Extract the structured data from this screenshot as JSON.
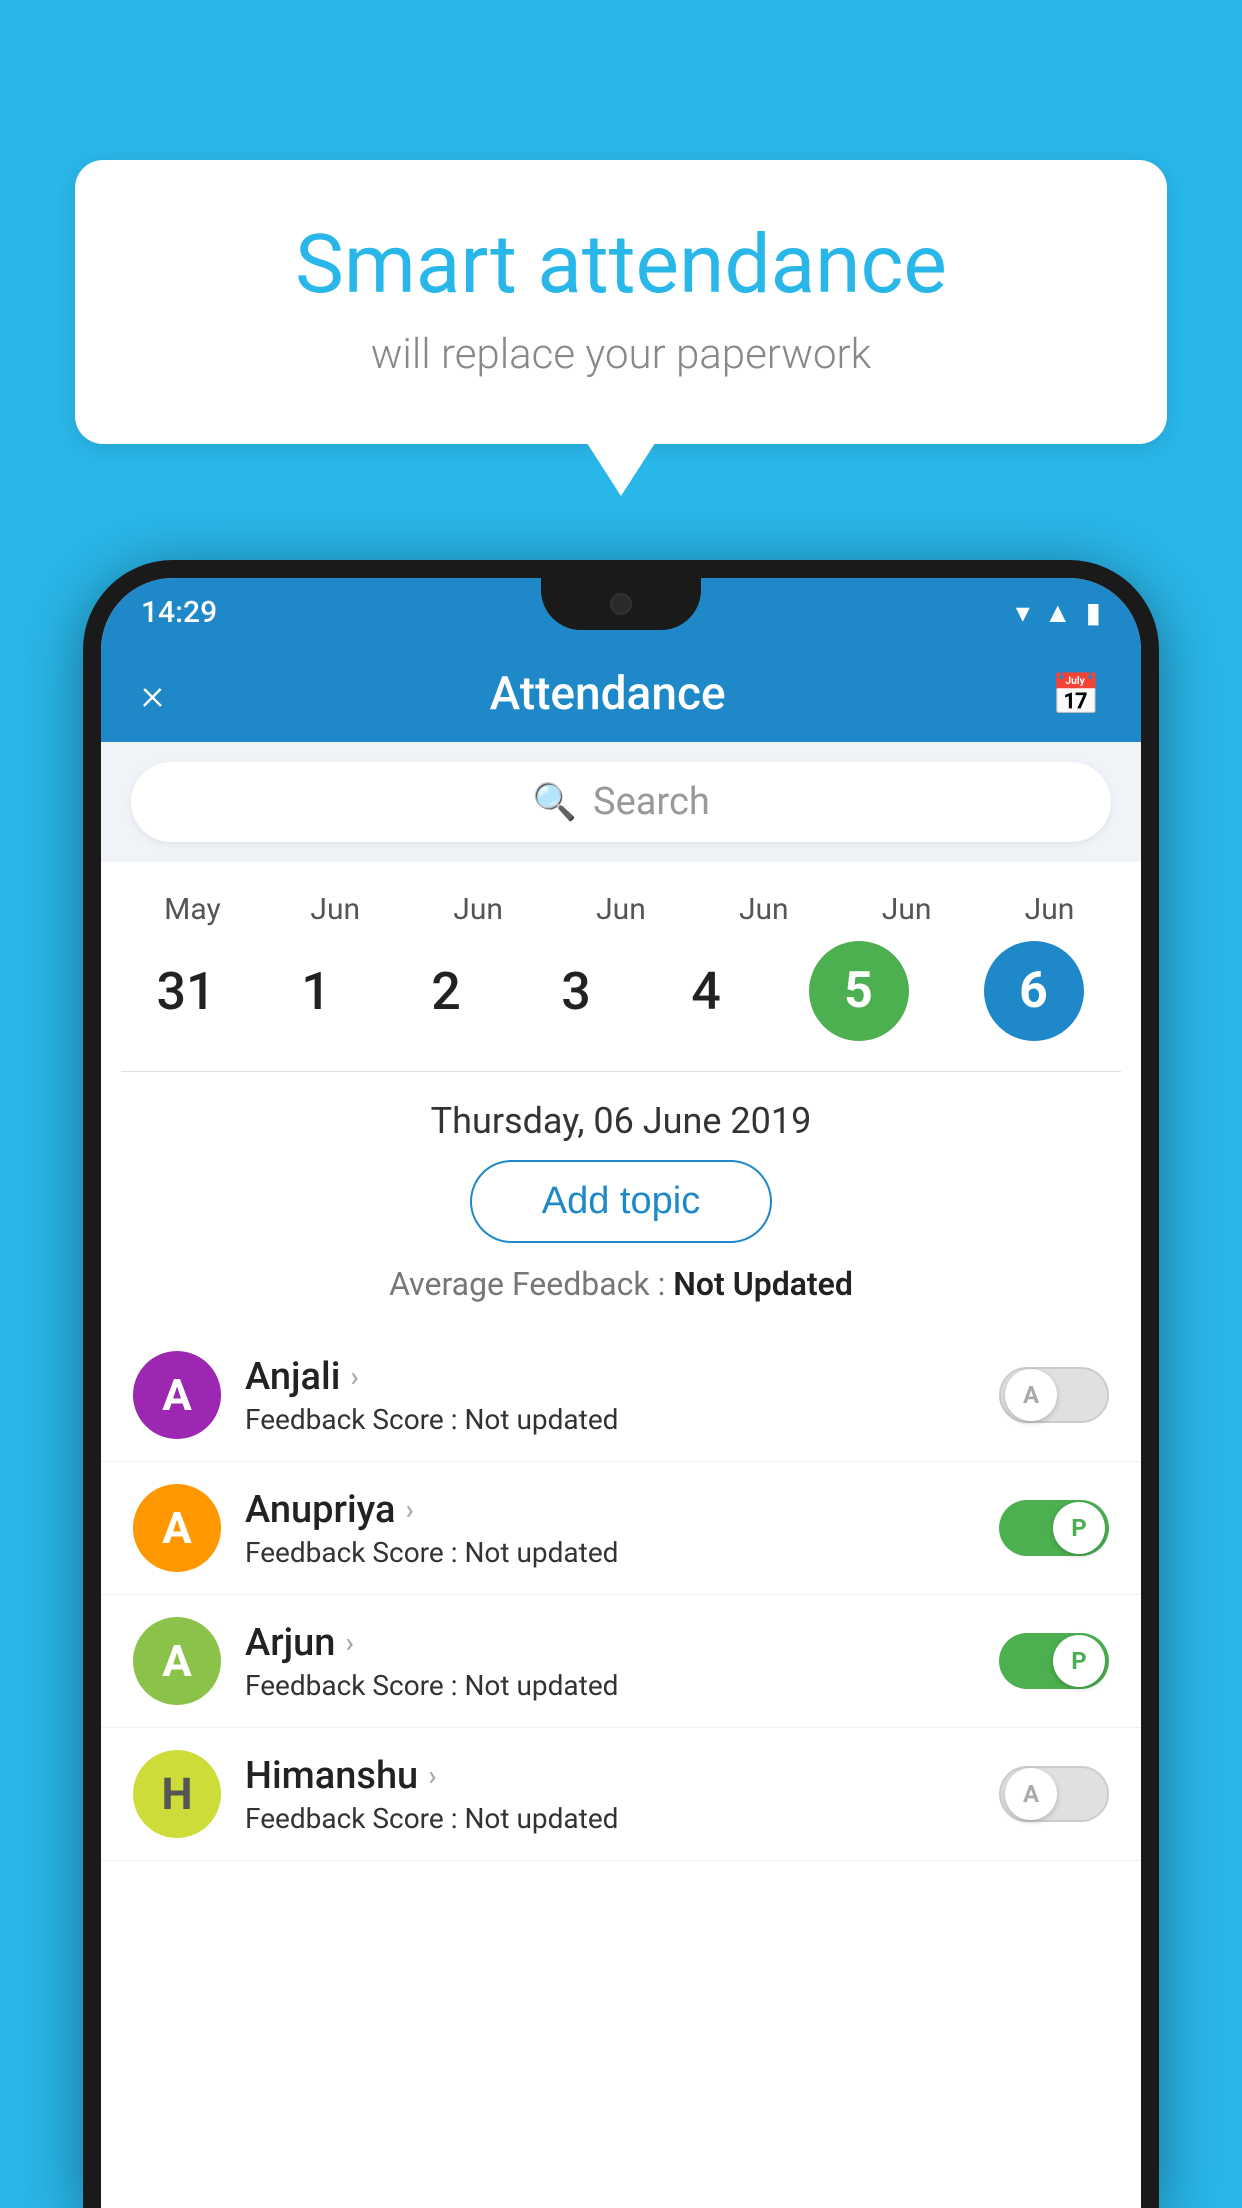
{
  "background_color": "#29b6e8",
  "bubble": {
    "title": "Smart attendance",
    "subtitle": "will replace your paperwork"
  },
  "status_bar": {
    "time": "14:29",
    "icons": [
      "▲",
      "▲",
      "▮"
    ]
  },
  "header": {
    "title": "Attendance",
    "close_label": "×",
    "calendar_icon": "📅"
  },
  "search": {
    "placeholder": "Search"
  },
  "calendar": {
    "months": [
      "May",
      "Jun",
      "Jun",
      "Jun",
      "Jun",
      "Jun",
      "Jun"
    ],
    "dates": [
      "31",
      "1",
      "2",
      "3",
      "4",
      "5",
      "6"
    ],
    "today_index": 5,
    "selected_index": 6
  },
  "selected_date": "Thursday, 06 June 2019",
  "add_topic_label": "Add topic",
  "feedback_summary": {
    "label": "Average Feedback :",
    "value": "Not Updated"
  },
  "students": [
    {
      "name": "Anjali",
      "avatar_letter": "A",
      "avatar_color": "purple",
      "feedback_label": "Feedback Score :",
      "feedback_value": "Not updated",
      "toggle": "off",
      "toggle_label": "A"
    },
    {
      "name": "Anupriya",
      "avatar_letter": "A",
      "avatar_color": "orange",
      "feedback_label": "Feedback Score :",
      "feedback_value": "Not updated",
      "toggle": "on",
      "toggle_label": "P"
    },
    {
      "name": "Arjun",
      "avatar_letter": "A",
      "avatar_color": "green",
      "feedback_label": "Feedback Score :",
      "feedback_value": "Not updated",
      "toggle": "on",
      "toggle_label": "P"
    },
    {
      "name": "Himanshu",
      "avatar_letter": "H",
      "avatar_color": "lime",
      "feedback_label": "Feedback Score :",
      "feedback_value": "Not updated",
      "toggle": "off",
      "toggle_label": "A"
    }
  ]
}
